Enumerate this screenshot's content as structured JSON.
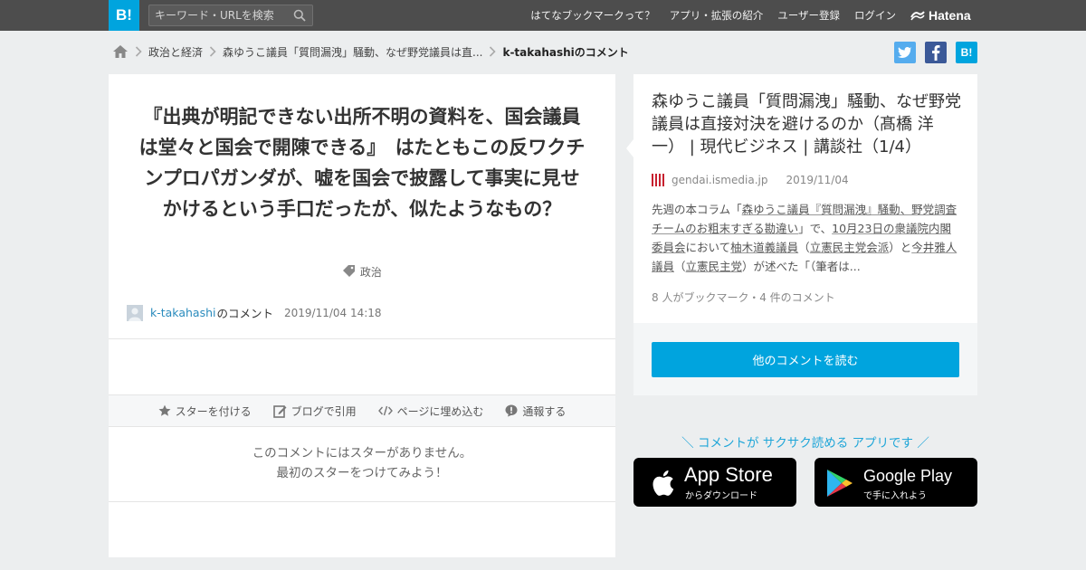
{
  "header": {
    "logo": "B!",
    "search_placeholder": "キーワード・URLを検索",
    "nav": [
      "はてなブックマークって？",
      "アプリ・拡張の紹介",
      "ユーザー登録",
      "ログイン"
    ],
    "brand": "Hatena"
  },
  "breadcrumb": {
    "items": [
      "政治と経済",
      "森ゆうこ議員「質問漏洩」騒動、なぜ野党議員は直...",
      "k-takahashiのコメント"
    ]
  },
  "share": {
    "b_label": "B!"
  },
  "comment": {
    "text": "『出典が明記できない出所不明の資料を、国会議員は堂々と国会で開陳できる』　はたともこの反ワクチンプロパガンダが、嘘を国会で披露して事実に見せかけるという手口だったが、似たようなもの？",
    "tag": "政治",
    "user": "k-takahashi",
    "user_suffix": "のコメント",
    "datetime": "2019/11/04 14:18",
    "actions": [
      "スターを付ける",
      "ブログで引用",
      "ページに埋め込む",
      "通報する"
    ],
    "no_star_line1": "このコメントにはスターがありません。",
    "no_star_line2": "最初のスターをつけてみよう！"
  },
  "entry": {
    "title": "森ゆうこ議員「質問漏洩」騒動、なぜ野党議員は直接対決を避けるのか（髙橋 洋一） | 現代ビジネス | 講談社（1/4）",
    "site": "gendai.ismedia.jp",
    "date": "2019/11/04",
    "summary_parts": [
      "先週の本コラム「",
      "森ゆうこ議員『質問漏洩』騒動、野党調査チームのお粗末すぎる勘違い",
      "」で、",
      "10月23日の衆議院内閣委員会",
      "において",
      "柚木道義議員",
      "（",
      "立憲民主党会派",
      "）と",
      "今井雅人議員",
      "（",
      "立憲民主党",
      "）が述べた「（筆者は..."
    ],
    "stats": "8 人がブックマーク・4 件のコメント",
    "read_button": "他のコメントを読む"
  },
  "promo": {
    "text": "＼ コメントが サクサク読める アプリです ／",
    "appstore_big": "App Store",
    "appstore_small": "からダウンロード",
    "googleplay_big": "Google Play",
    "googleplay_small": "で手に入れよう"
  },
  "colors": {
    "accent": "#00a4de",
    "topbar": "#4d4d4d",
    "twitter": "#55acee",
    "facebook": "#3b5998"
  }
}
